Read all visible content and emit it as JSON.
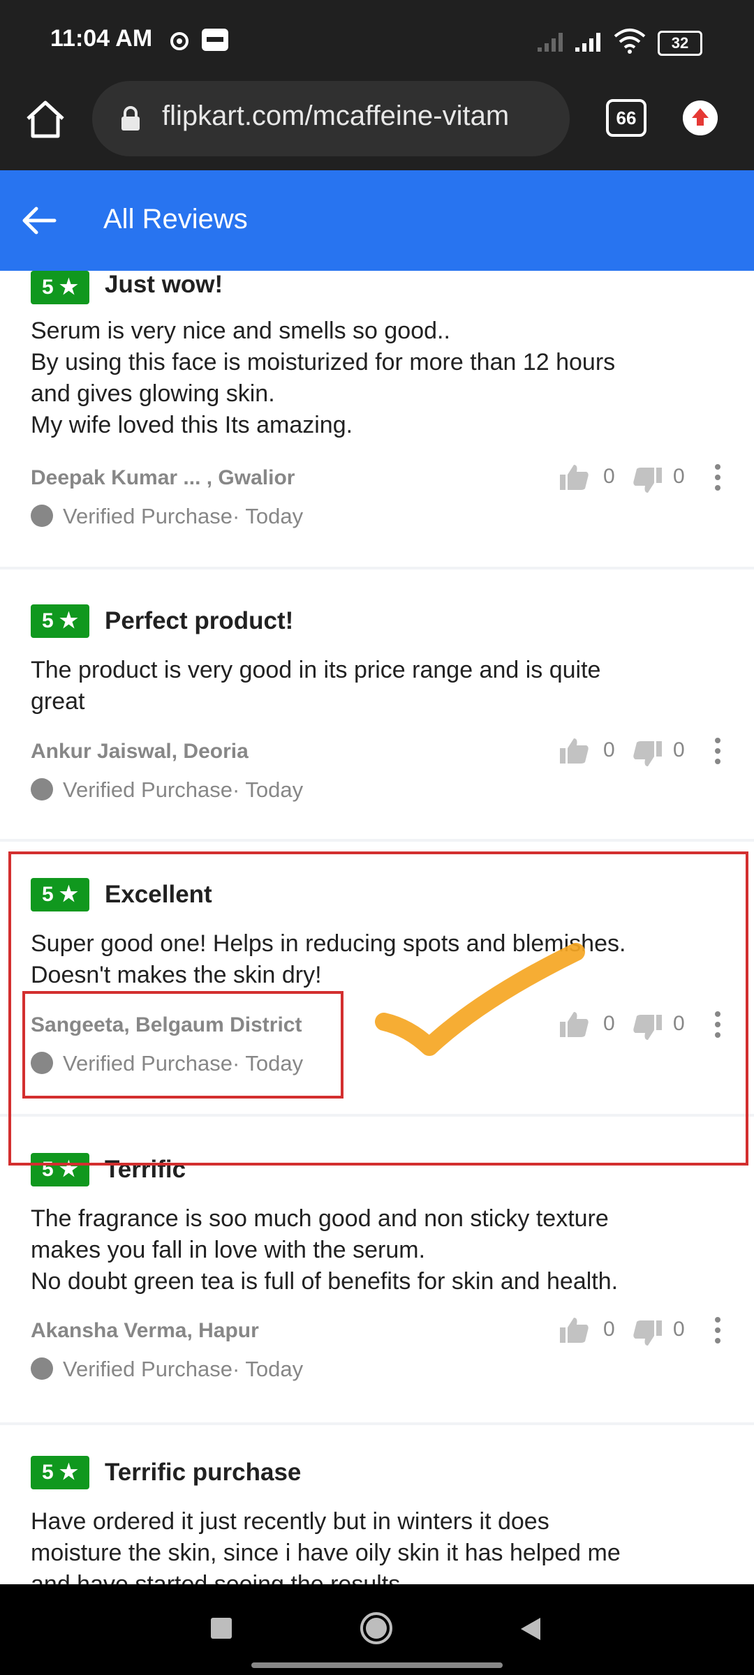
{
  "status_bar": {
    "time": "11:04 AM",
    "battery": "32"
  },
  "browser": {
    "url": "flipkart.com/mcaffeine-vitam",
    "tab_count": "66"
  },
  "app_bar": {
    "title": "All Reviews"
  },
  "reviews": [
    {
      "rating": "5 ★",
      "title": "Just wow!",
      "body": [
        "Serum is very nice and smells so good..",
        "By using this face is moisturized for more than 12 hours",
        "and gives glowing skin.",
        "My wife loved this Its amazing."
      ],
      "author": "Deepak Kumar ... , Gwalior",
      "verified": "Verified Purchase· Today",
      "likes": "0",
      "dislikes": "0"
    },
    {
      "rating": "5 ★",
      "title": "Perfect product!",
      "body": [
        "The product is very good in its price range and is quite",
        "great"
      ],
      "author": "Ankur Jaiswal, Deoria",
      "verified": "Verified Purchase· Today",
      "likes": "0",
      "dislikes": "0"
    },
    {
      "rating": "5 ★",
      "title": "Excellent",
      "body": [
        "Super good one! Helps in reducing spots and blemishes.",
        "Doesn't makes the skin dry!"
      ],
      "author": "Sangeeta, Belgaum District",
      "verified": "Verified Purchase· Today",
      "likes": "0",
      "dislikes": "0"
    },
    {
      "rating": "5 ★",
      "title": "Terrific",
      "body": [
        "The fragrance is soo much good and non sticky texture",
        "makes you fall in love with the serum.",
        "No doubt green tea is full of benefits for skin and health."
      ],
      "author": "Akansha Verma, Hapur",
      "verified": "Verified Purchase· Today",
      "likes": "0",
      "dislikes": "0"
    },
    {
      "rating": "5 ★",
      "title": "Terrific purchase",
      "body": [
        "Have ordered it just recently but in winters it does",
        "moisture the skin, since i have oily skin it has helped me",
        "and have started seeing the results"
      ],
      "author": "",
      "verified": "",
      "likes": "",
      "dislikes": ""
    }
  ],
  "colors": {
    "brand_blue": "#2874f0",
    "rating_green": "#10981e",
    "annotation_red": "#d32f2f",
    "annotation_check": "#f5a623"
  }
}
